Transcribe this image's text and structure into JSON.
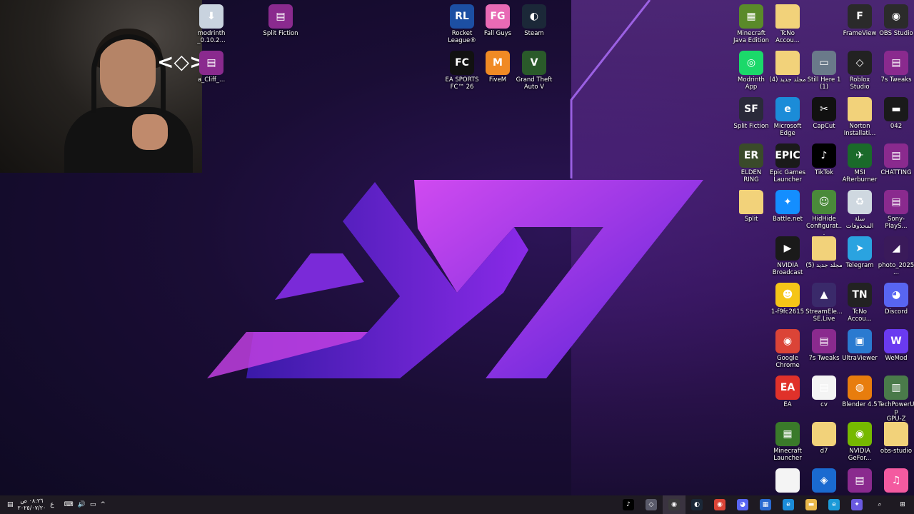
{
  "webcam": {
    "overlay_glyph": "<◇>"
  },
  "desktop_icons_left": [
    {
      "label": "modrinth\n_0.10.2...",
      "icon": "installer-icon",
      "color": "#c9d3df",
      "glyph": "⬇"
    },
    {
      "label": "Split Fiction",
      "icon": "winrar-icon",
      "color": "#8a2a8e",
      "glyph": "▤"
    },
    {
      "label": "a_Cliff_...",
      "icon": "winrar-icon",
      "color": "#8a2a8e",
      "glyph": "▤"
    }
  ],
  "desktop_icons_center": [
    {
      "label": "Rocket\nLeague®",
      "icon": "rocket-league-icon",
      "color": "#1c4fa3",
      "glyph": "RL"
    },
    {
      "label": "Fall Guys",
      "icon": "fall-guys-icon",
      "color": "#e86ab5",
      "glyph": "FG"
    },
    {
      "label": "Steam",
      "icon": "steam-icon",
      "color": "#1b2838",
      "glyph": "◐"
    },
    {
      "label": "EA SPORTS\nFC™ 26",
      "icon": "ea-fc-icon",
      "color": "#111111",
      "glyph": "FC"
    },
    {
      "label": "FiveM",
      "icon": "fivem-icon",
      "color": "#f08a24",
      "glyph": "M"
    },
    {
      "label": "Grand Theft\nAuto V",
      "icon": "gta-icon",
      "color": "#2a5a2a",
      "glyph": "V"
    }
  ],
  "desktop_icons_right": [
    {
      "label": "Minecraft\nJava Edition",
      "icon": "minecraft-java-icon",
      "color": "#5a8a2a",
      "glyph": "▦"
    },
    {
      "label": "TcNo\nAccou...",
      "icon": "folder-icon",
      "color": "#f2d27a",
      "glyph": ""
    },
    {
      "label": "",
      "icon": "blank-icon",
      "color": "transparent",
      "glyph": ""
    },
    {
      "label": "FrameView",
      "icon": "frameview-icon",
      "color": "#2a2a2a",
      "glyph": "F"
    },
    {
      "label": "OBS Studio",
      "icon": "obs-icon",
      "color": "#2b2b2b",
      "glyph": "◉"
    },
    {
      "label": "Modrinth\nApp",
      "icon": "modrinth-icon",
      "color": "#1bd96a",
      "glyph": "◎"
    },
    {
      "label": "مجلد جديد (4)",
      "icon": "folder-icon",
      "color": "#f2d27a",
      "glyph": ""
    },
    {
      "label": "Still Here 1\n(1)",
      "icon": "video-thumb-icon",
      "color": "#6a7a8a",
      "glyph": "▭"
    },
    {
      "label": "Roblox\nStudio",
      "icon": "roblox-studio-icon",
      "color": "#222222",
      "glyph": "◇"
    },
    {
      "label": "7s Tweaks",
      "icon": "winrar-icon",
      "color": "#8a2a8e",
      "glyph": "▤"
    },
    {
      "label": "Split Fiction",
      "icon": "split-fiction-icon",
      "color": "#2a2a3a",
      "glyph": "SF"
    },
    {
      "label": "Microsoft\nEdge",
      "icon": "edge-icon",
      "color": "#1b8cd8",
      "glyph": "e"
    },
    {
      "label": "CapCut",
      "icon": "capcut-icon",
      "color": "#111111",
      "glyph": "✂"
    },
    {
      "label": "Norton\nInstallati...",
      "icon": "folder-icon",
      "color": "#f2d27a",
      "glyph": ""
    },
    {
      "label": "042",
      "icon": "image-thumb-icon",
      "color": "#1a1a1a",
      "glyph": "▬"
    },
    {
      "label": "ELDEN RING",
      "icon": "elden-ring-icon",
      "color": "#3a4a2a",
      "glyph": "ER"
    },
    {
      "label": "Epic Games\nLauncher",
      "icon": "epic-games-icon",
      "color": "#1a1a1a",
      "glyph": "EPIC"
    },
    {
      "label": "TikTok",
      "icon": "tiktok-icon",
      "color": "#000000",
      "glyph": "♪"
    },
    {
      "label": "MSI\nAfterburner",
      "icon": "msi-afterburner-icon",
      "color": "#1a6a2a",
      "glyph": "✈"
    },
    {
      "label": "CHATTING",
      "icon": "winrar-icon",
      "color": "#8a2a8e",
      "glyph": "▤"
    },
    {
      "label": "Split",
      "icon": "folder-icon",
      "color": "#f2d27a",
      "glyph": ""
    },
    {
      "label": "Battle.net",
      "icon": "battlenet-icon",
      "color": "#148eff",
      "glyph": "✦"
    },
    {
      "label": "HidHide\nConfigurat...",
      "icon": "hidhide-icon",
      "color": "#4a8a3a",
      "glyph": "☺"
    },
    {
      "label": "سلة\nالمحذوفات",
      "icon": "recycle-bin-icon",
      "color": "#cfd8e0",
      "glyph": "♻"
    },
    {
      "label": "Sony- PlayS...",
      "icon": "winrar-icon",
      "color": "#8a2a8e",
      "glyph": "▤"
    },
    {
      "label": "NVIDIA\nBroadcast",
      "icon": "nvidia-broadcast-icon",
      "color": "#1a1a1a",
      "glyph": "▶"
    },
    {
      "label": "مجلد جديد (5)",
      "icon": "folder-icon",
      "color": "#f2d27a",
      "glyph": ""
    },
    {
      "label": "Telegram",
      "icon": "telegram-icon",
      "color": "#2aa3e0",
      "glyph": "➤"
    },
    {
      "label": "photo_2025...",
      "icon": "image-thumb-icon",
      "color": "#3a1a5a",
      "glyph": "◢"
    },
    {
      "label": "1-f9fc2615",
      "icon": "emoji-icon",
      "color": "#f5c518",
      "glyph": "☻"
    },
    {
      "label": "StreamEle...\nSE.Live",
      "icon": "streamelements-icon",
      "color": "#3a2a6a",
      "glyph": "▲"
    },
    {
      "label": "TcNo\nAccou...",
      "icon": "tcno-icon",
      "color": "#222222",
      "glyph": "TN"
    },
    {
      "label": "Discord",
      "icon": "discord-icon",
      "color": "#5865f2",
      "glyph": "◕"
    },
    {
      "label": "Google\nChrome",
      "icon": "chrome-icon",
      "color": "#db4437",
      "glyph": "◉"
    },
    {
      "label": "7s Tweaks",
      "icon": "winrar-icon",
      "color": "#8a2a8e",
      "glyph": "▤"
    },
    {
      "label": "UltraViewer",
      "icon": "ultraviewer-icon",
      "color": "#2a7ad0",
      "glyph": "▣"
    },
    {
      "label": "WeMod",
      "icon": "wemod-icon",
      "color": "#6a3af0",
      "glyph": "W"
    },
    {
      "label": "EA",
      "icon": "ea-icon",
      "color": "#e0312a",
      "glyph": "EA"
    },
    {
      "label": "cv",
      "icon": "document-icon",
      "color": "#f4f4f4",
      "glyph": "▤"
    },
    {
      "label": "Blender 4.5",
      "icon": "blender-icon",
      "color": "#e87d0d",
      "glyph": "◍"
    },
    {
      "label": "TechPowerUp\nGPU-Z",
      "icon": "gpuz-icon",
      "color": "#4a7a4a",
      "glyph": "▥"
    },
    {
      "label": "Minecraft\nLauncher",
      "icon": "minecraft-launcher-icon",
      "color": "#3a7a2a",
      "glyph": "▦"
    },
    {
      "label": "d7",
      "icon": "document-icon",
      "color": "#f2d27a",
      "glyph": ""
    },
    {
      "label": "NVIDIA\nGeFor...",
      "icon": "nvidia-geforce-icon",
      "color": "#76b900",
      "glyph": "◉"
    },
    {
      "label": "obs-studio",
      "icon": "folder-icon",
      "color": "#f2d27a",
      "glyph": ""
    },
    {
      "label": "",
      "icon": "blank-document-icon",
      "color": "#f4f4f4",
      "glyph": ""
    },
    {
      "label": "",
      "icon": "app-icon",
      "color": "#1a6ad0",
      "glyph": "◈"
    },
    {
      "label": "",
      "icon": "winrar-icon",
      "color": "#8a2a8e",
      "glyph": "▤"
    },
    {
      "label": "",
      "icon": "itunes-icon",
      "color": "#f45aa0",
      "glyph": "♫"
    }
  ],
  "taskbar": {
    "time": "٠٨:٢٦ ص",
    "date": "٢٠٢٥/٠٧/٢٠",
    "lang": "ع",
    "notification_glyph": "▤",
    "keyboard_glyph": "⌨",
    "volume_glyph": "🔊",
    "network_glyph": "▭",
    "chevron_glyph": "^",
    "apps": [
      {
        "name": "tiktok-taskbar-icon",
        "glyph": "♪",
        "color": "#000000"
      },
      {
        "name": "app-taskbar-icon",
        "glyph": "◇",
        "color": "#5a5a6a"
      },
      {
        "name": "obs-taskbar-icon",
        "glyph": "◉",
        "color": "#3a3a3a",
        "active": true
      },
      {
        "name": "steam-taskbar-icon",
        "glyph": "◐",
        "color": "#1b2838"
      },
      {
        "name": "chrome-taskbar-icon",
        "glyph": "◉",
        "color": "#db4437"
      },
      {
        "name": "discord-taskbar-icon",
        "glyph": "◕",
        "color": "#5865f2"
      },
      {
        "name": "store-taskbar-icon",
        "glyph": "▦",
        "color": "#2a6ad0"
      },
      {
        "name": "edge-taskbar-icon",
        "glyph": "e",
        "color": "#1b8cd8"
      },
      {
        "name": "file-explorer-taskbar-icon",
        "glyph": "▬",
        "color": "#e8b84a"
      },
      {
        "name": "edge-alt-taskbar-icon",
        "glyph": "e",
        "color": "#1b9ad8"
      },
      {
        "name": "copilot-taskbar-icon",
        "glyph": "✦",
        "color": "#6a5ae0"
      },
      {
        "name": "search-taskbar-icon",
        "glyph": "⌕",
        "color": "transparent"
      },
      {
        "name": "start-taskbar-icon",
        "glyph": "⊞",
        "color": "transparent"
      }
    ]
  }
}
